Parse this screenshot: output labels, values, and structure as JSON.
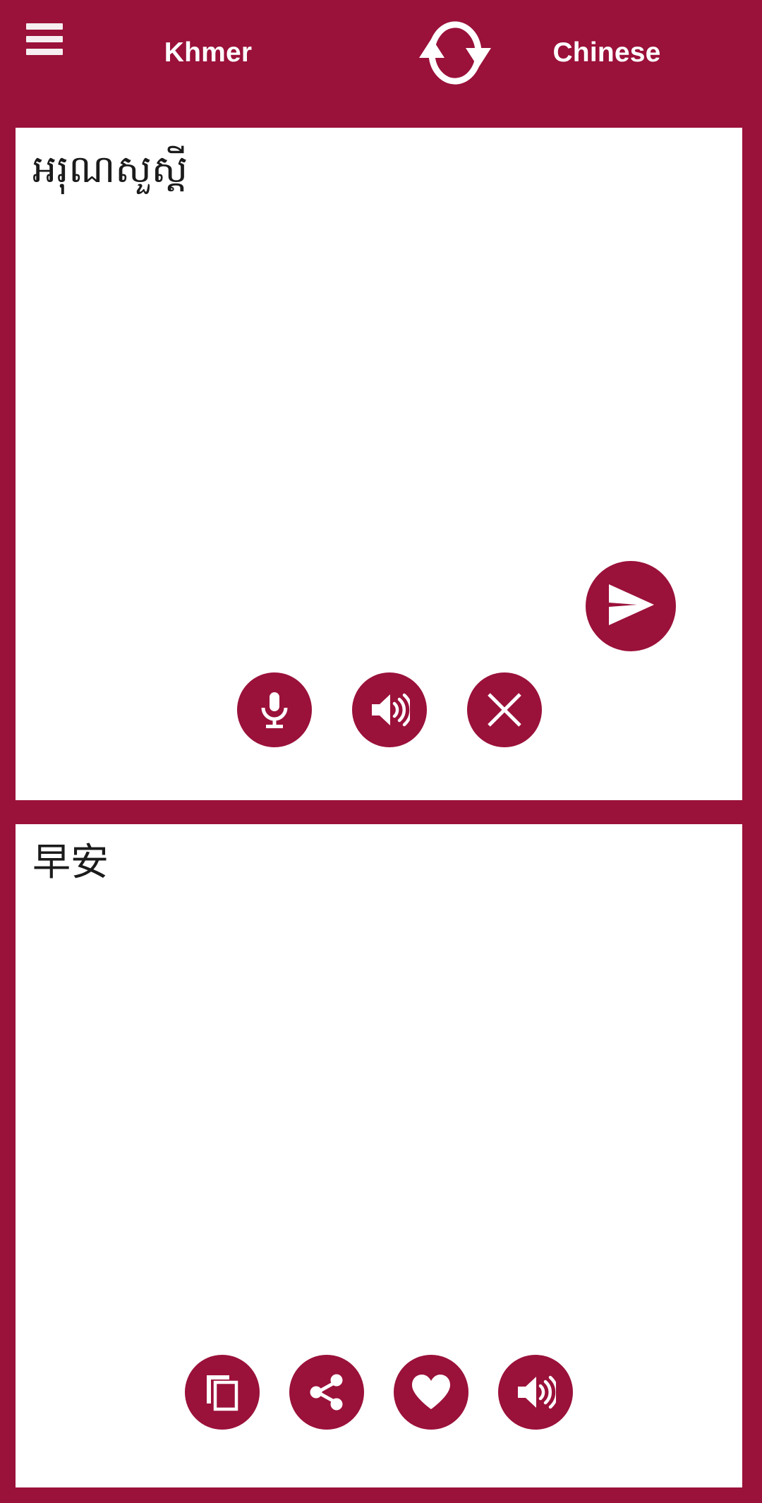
{
  "app": {
    "accent_color": "#9a113a",
    "card_background": "#ffffff",
    "icon_color": "#ffffff",
    "text_color": "#1b1b1b"
  },
  "header": {
    "menu_label": "menu",
    "source_language": "Khmer",
    "target_language": "Chinese",
    "swap_label": "swap languages"
  },
  "source_panel": {
    "text": "អរុណសួស្តី",
    "placeholder": "",
    "actions": [
      {
        "name": "microphone",
        "label": "Speak"
      },
      {
        "name": "speaker",
        "label": "Listen"
      },
      {
        "name": "clear",
        "label": "Clear"
      }
    ]
  },
  "send_button": {
    "label": "Translate",
    "icon": "send-icon"
  },
  "target_panel": {
    "text": "早安",
    "actions": [
      {
        "name": "copy",
        "label": "Copy"
      },
      {
        "name": "share",
        "label": "Share"
      },
      {
        "name": "favorite",
        "label": "Favorite"
      },
      {
        "name": "speaker",
        "label": "Listen"
      }
    ]
  }
}
